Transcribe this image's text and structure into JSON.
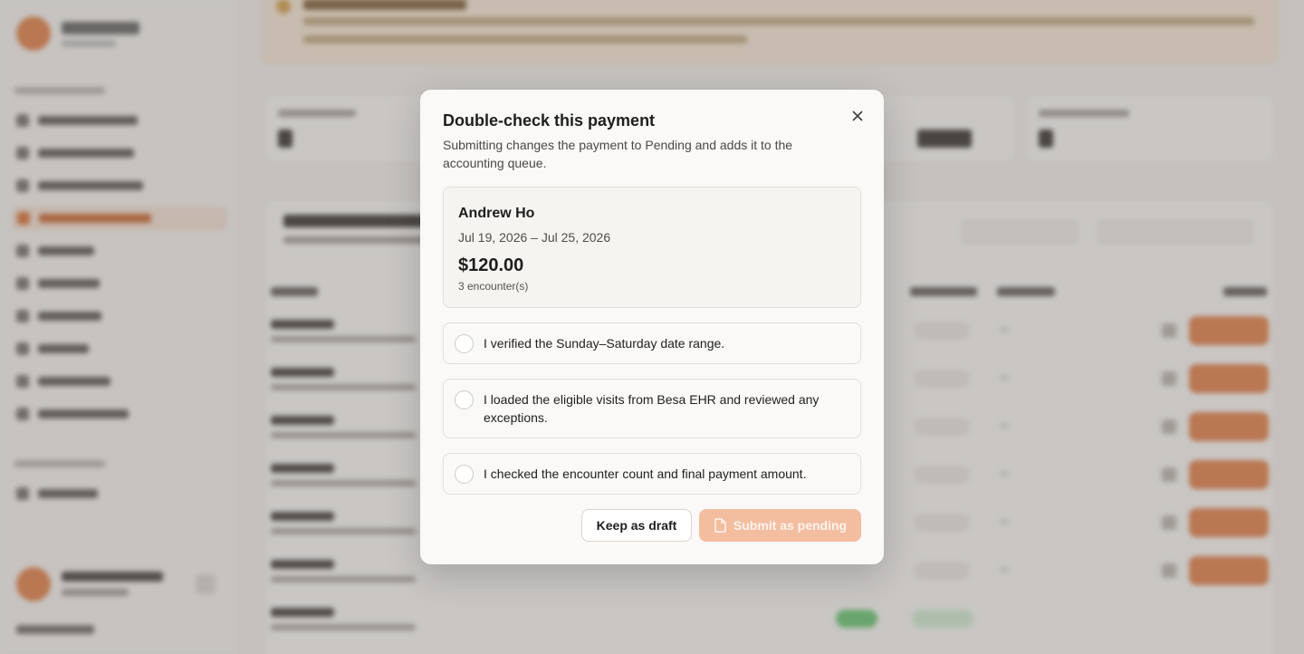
{
  "modal": {
    "title": "Double-check this payment",
    "description": "Submitting changes the payment to Pending and adds it to the accounting queue.",
    "close_icon": "close-icon",
    "summary": {
      "name": "Andrew Ho",
      "date_range": "Jul 19, 2026 – Jul 25, 2026",
      "amount": "$120.00",
      "encounters": "3 encounter(s)"
    },
    "checklist": [
      {
        "label": "I verified the Sunday–Saturday date range.",
        "checked": false
      },
      {
        "label": "I loaded the eligible visits from Besa EHR and reviewed any exceptions.",
        "checked": false
      },
      {
        "label": "I checked the encounter count and final payment amount.",
        "checked": false
      }
    ],
    "buttons": {
      "keep_draft": "Keep as draft",
      "submit": "Submit as pending",
      "submit_icon": "document-icon",
      "submit_enabled": false
    }
  },
  "colors": {
    "accent": "#e07a3f",
    "accent_disabled": "#f3bda0",
    "overlay": "rgba(120,116,112,0.38)"
  }
}
